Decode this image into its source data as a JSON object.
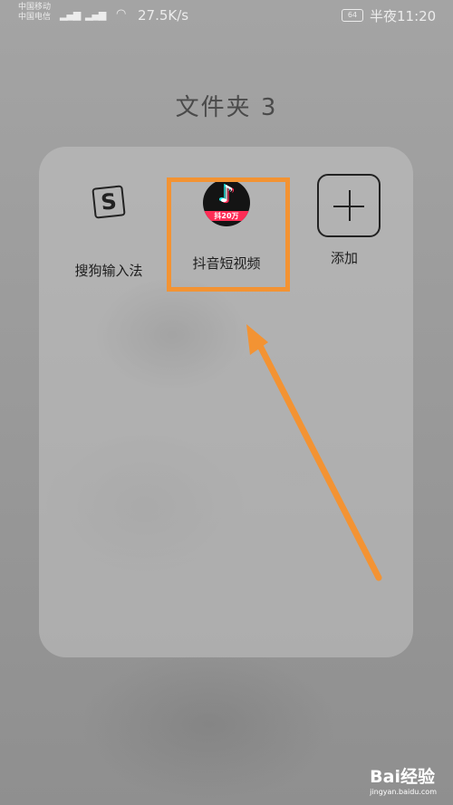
{
  "status_bar": {
    "carrier_1": "中国移动",
    "carrier_2": "中国电信",
    "signal_1_badge": "2G",
    "signal_2_badge": "4G",
    "network_speed": "27.5K/s",
    "battery_level": "64",
    "time": "半夜11:20"
  },
  "folder": {
    "title": "文件夹 3",
    "apps": [
      {
        "label": "搜狗输入法",
        "icon": "sogou-input-icon",
        "glyph": "S"
      },
      {
        "label": "抖音短视频",
        "icon": "douyin-icon",
        "badge": "抖20万"
      },
      {
        "label": "添加",
        "icon": "plus-icon"
      }
    ]
  },
  "annotation": {
    "highlight_color": "#f39333",
    "arrow_color": "#f39333"
  },
  "watermark": {
    "brand": "Bai经验",
    "url": "jingyan.baidu.com"
  }
}
